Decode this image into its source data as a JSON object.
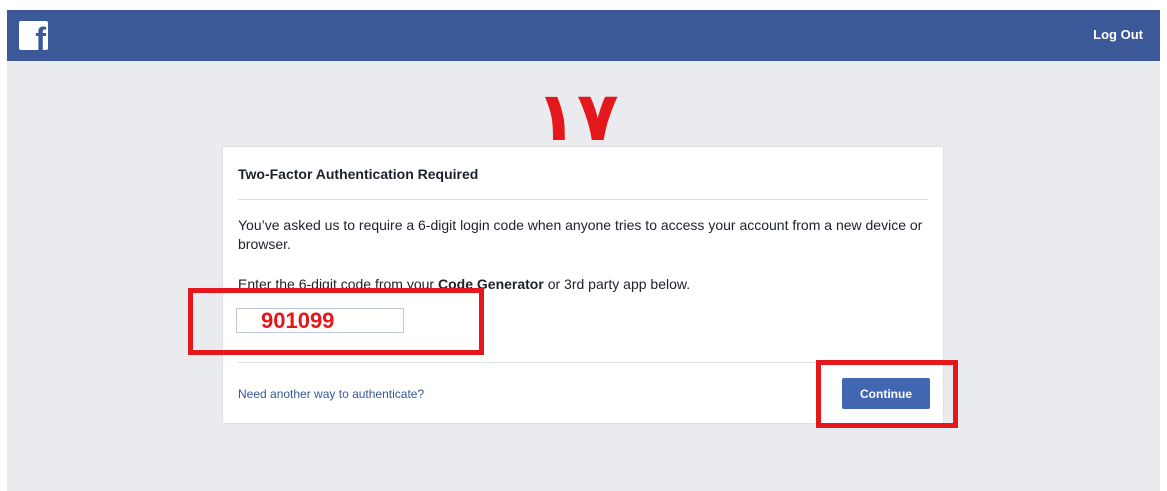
{
  "header": {
    "logo_letter": "f",
    "logout_label": "Log Out"
  },
  "annotation": {
    "step_number": "١٧"
  },
  "card": {
    "title": "Two-Factor Authentication Required",
    "description": "You’ve asked us to require a 6-digit login code when anyone tries to access your account from a new device or browser.",
    "instruction_prefix": "Enter the 6-digit code from your ",
    "instruction_bold": "Code Generator",
    "instruction_suffix": " or 3rd party app below.",
    "code_value": "901099",
    "alt_link": "Need another way to authenticate?",
    "continue_label": "Continue"
  },
  "colors": {
    "brand_blue": "#3b5998",
    "button_blue": "#4267b2",
    "highlight_red": "#e3171c",
    "background": "#e9ebee"
  }
}
